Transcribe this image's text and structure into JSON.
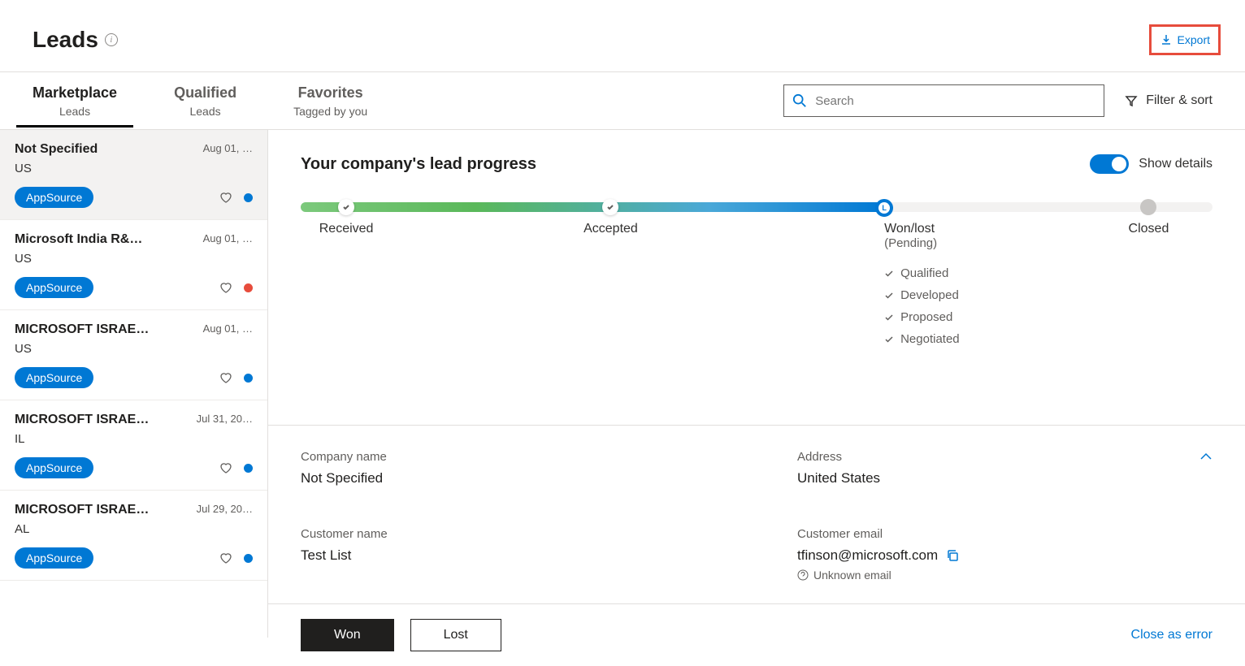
{
  "header": {
    "title": "Leads",
    "export_label": "Export"
  },
  "tabs": [
    {
      "main": "Marketplace",
      "sub": "Leads",
      "active": true
    },
    {
      "main": "Qualified",
      "sub": "Leads",
      "active": false
    },
    {
      "main": "Favorites",
      "sub": "Tagged by you",
      "active": false
    }
  ],
  "search": {
    "placeholder": "Search"
  },
  "filter": {
    "label": "Filter & sort"
  },
  "leads": [
    {
      "name": "Not Specified",
      "date": "Aug 01, …",
      "location": "US",
      "badge": "AppSource",
      "dot": "#0078d4",
      "selected": true
    },
    {
      "name": "Microsoft India R&…",
      "date": "Aug 01, …",
      "location": "US",
      "badge": "AppSource",
      "dot": "#e74c3c",
      "selected": false
    },
    {
      "name": "MICROSOFT ISRAE…",
      "date": "Aug 01, …",
      "location": "US",
      "badge": "AppSource",
      "dot": "#0078d4",
      "selected": false
    },
    {
      "name": "MICROSOFT ISRAE…",
      "date": "Jul 31, 20…",
      "location": "IL",
      "badge": "AppSource",
      "dot": "#0078d4",
      "selected": false
    },
    {
      "name": "MICROSOFT ISRAE…",
      "date": "Jul 29, 20…",
      "location": "AL",
      "badge": "AppSource",
      "dot": "#0078d4",
      "selected": false
    }
  ],
  "progress": {
    "title": "Your company's lead progress",
    "show_details_label": "Show details",
    "stages": {
      "received": "Received",
      "accepted": "Accepted",
      "wonlost": "Won/lost",
      "wonlost_sub": "(Pending)",
      "closed": "Closed"
    },
    "checklist": [
      "Qualified",
      "Developed",
      "Proposed",
      "Negotiated"
    ]
  },
  "details": {
    "company_name_label": "Company name",
    "company_name": "Not Specified",
    "address_label": "Address",
    "address": "United States",
    "customer_name_label": "Customer name",
    "customer_name": "Test List",
    "customer_email_label": "Customer email",
    "customer_email": "tfinson@microsoft.com",
    "email_status": "Unknown email"
  },
  "actions": {
    "won": "Won",
    "lost": "Lost",
    "close_as_error": "Close as error"
  }
}
